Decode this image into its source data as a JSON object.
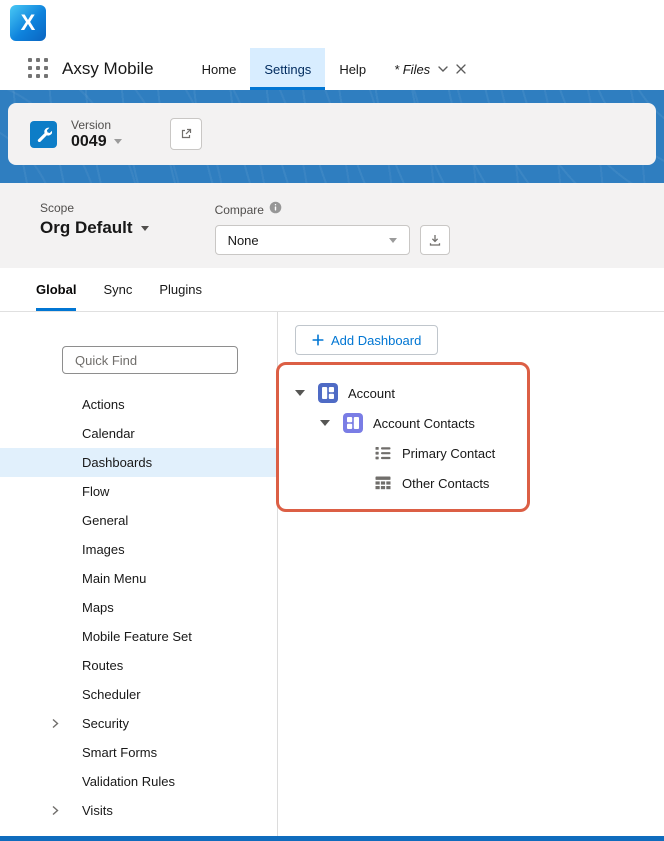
{
  "colors": {
    "accent": "#0176d3",
    "banner_blue": "#2f7ec0",
    "active_tab_bg": "#d8edff",
    "selected_item_bg": "#e1f0fc",
    "annotation_red": "#dc5f45",
    "account_icon": "#4f6bc5",
    "account_contacts_icon": "#7a7de5"
  },
  "logo": {
    "letter": "X"
  },
  "top_nav": {
    "app_name": "Axsy Mobile",
    "items": [
      {
        "label": "Home",
        "active": false
      },
      {
        "label": "Settings",
        "active": true
      },
      {
        "label": "Help",
        "active": false
      },
      {
        "label": "* Files",
        "active": false
      }
    ]
  },
  "version_bar": {
    "label": "Version",
    "value": "0049"
  },
  "toolbar": {
    "scope_label": "Scope",
    "scope_value": "Org Default",
    "compare_label": "Compare",
    "compare_value": "None"
  },
  "content_tabs": [
    {
      "label": "Global",
      "active": true
    },
    {
      "label": "Sync",
      "active": false
    },
    {
      "label": "Plugins",
      "active": false
    }
  ],
  "sidebar": {
    "quick_find_placeholder": "Quick Find",
    "items": [
      {
        "label": "Actions"
      },
      {
        "label": "Calendar"
      },
      {
        "label": "Dashboards",
        "selected": true
      },
      {
        "label": "Flow"
      },
      {
        "label": "General"
      },
      {
        "label": "Images"
      },
      {
        "label": "Main Menu"
      },
      {
        "label": "Maps"
      },
      {
        "label": "Mobile Feature Set"
      },
      {
        "label": "Routes"
      },
      {
        "label": "Scheduler"
      },
      {
        "label": "Security",
        "expandable": true
      },
      {
        "label": "Smart Forms"
      },
      {
        "label": "Validation Rules"
      },
      {
        "label": "Visits",
        "expandable": true
      }
    ]
  },
  "main": {
    "add_dashboard_label": "Add Dashboard",
    "tree": [
      {
        "label": "Account",
        "level": 0,
        "expanded": true,
        "icon": "account-object-icon"
      },
      {
        "label": "Account Contacts",
        "level": 1,
        "expanded": true,
        "icon": "account-contacts-object-icon"
      },
      {
        "label": "Primary Contact",
        "level": 2,
        "icon": "list-view-icon"
      },
      {
        "label": "Other Contacts",
        "level": 2,
        "icon": "table-icon"
      }
    ]
  }
}
